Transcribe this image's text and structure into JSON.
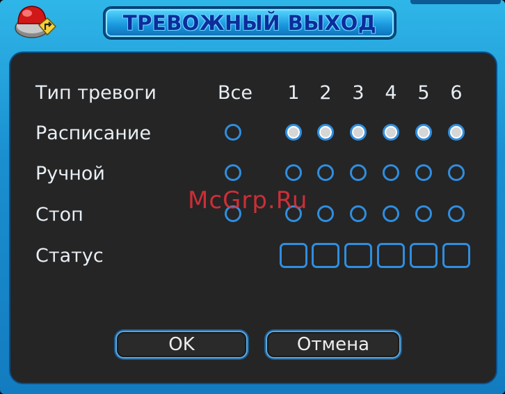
{
  "window": {
    "title": "ТРЕВОЖНЫЙ ВЫХОД"
  },
  "table": {
    "header_label": "Тип тревоги",
    "all_label": "Все",
    "columns": [
      "1",
      "2",
      "3",
      "4",
      "5",
      "6"
    ],
    "rows": [
      {
        "label": "Расписание",
        "all_selected": false,
        "selected": [
          true,
          true,
          true,
          true,
          true,
          true
        ]
      },
      {
        "label": "Ручной",
        "all_selected": false,
        "selected": [
          false,
          false,
          false,
          false,
          false,
          false
        ]
      },
      {
        "label": "Стоп",
        "all_selected": false,
        "selected": [
          false,
          false,
          false,
          false,
          false,
          false
        ]
      }
    ],
    "status_label": "Статус"
  },
  "buttons": {
    "ok_label": "OK",
    "cancel_label": "Отмена"
  },
  "watermark": "McGrp.Ru",
  "colors": {
    "accent": "#2f8ee0",
    "panel": "#252525",
    "title_bar": "#1a8fd0",
    "title_text": "#0c2e9a",
    "watermark": "#e0303a"
  },
  "icons": {
    "title": "alarm-siren-icon"
  }
}
